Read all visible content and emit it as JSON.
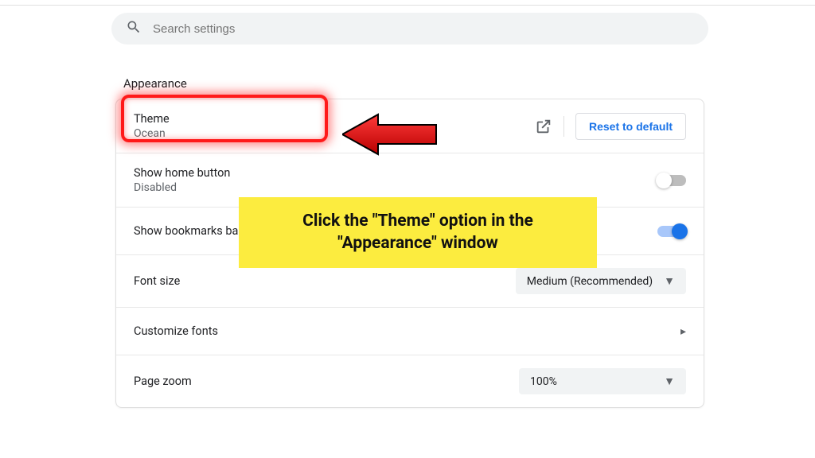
{
  "search": {
    "placeholder": "Search settings"
  },
  "section": {
    "title": "Appearance"
  },
  "theme": {
    "label": "Theme",
    "value": "Ocean",
    "reset_label": "Reset to default"
  },
  "home_button": {
    "label": "Show home button",
    "status": "Disabled",
    "enabled": false
  },
  "bookmarks": {
    "label": "Show bookmarks bar",
    "enabled": true
  },
  "font_size": {
    "label": "Font size",
    "value": "Medium (Recommended)"
  },
  "customize_fonts": {
    "label": "Customize fonts"
  },
  "page_zoom": {
    "label": "Page zoom",
    "value": "100%"
  },
  "annotation": {
    "text": "Click the \"Theme\" option in the \"Appearance\" window"
  }
}
